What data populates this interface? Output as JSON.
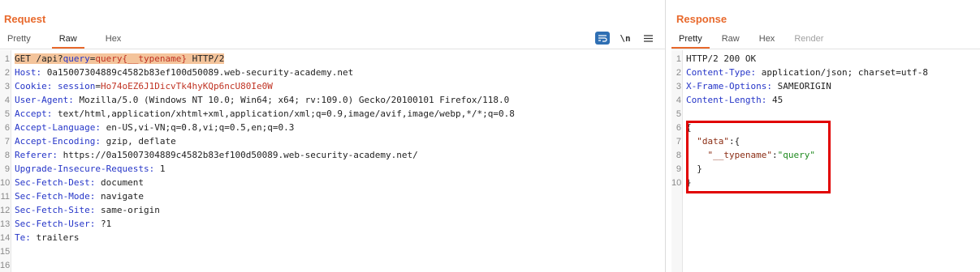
{
  "request": {
    "title": "Request",
    "tabs": [
      "Pretty",
      "Raw",
      "Hex"
    ],
    "active_tab": "Raw",
    "toolbar": {
      "pretty_toggle_icon": "wrap-lines-icon",
      "newline_label": "\\n",
      "menu_icon": "hamburger-icon"
    },
    "lines": [
      {
        "num": "1",
        "parts": [
          {
            "t": "GET /api?",
            "c": "hl"
          },
          {
            "t": "query",
            "c": "hl blue"
          },
          {
            "t": "=",
            "c": "hl"
          },
          {
            "t": "query{__typename}",
            "c": "hl red"
          },
          {
            "t": " HTTP/2",
            "c": "hl"
          }
        ]
      },
      {
        "num": "2",
        "parts": [
          {
            "t": "Host: ",
            "c": "blue"
          },
          {
            "t": "0a15007304889c4582b83ef100d50089.web-security-academy.net",
            "c": ""
          }
        ]
      },
      {
        "num": "3",
        "parts": [
          {
            "t": "Cookie: ",
            "c": "blue"
          },
          {
            "t": "session",
            "c": "blue"
          },
          {
            "t": "=",
            "c": ""
          },
          {
            "t": "Ho74oEZ6J1DicvTk4hyKQp6ncU80Ie0W",
            "c": "red"
          }
        ]
      },
      {
        "num": "4",
        "parts": [
          {
            "t": "User-Agent: ",
            "c": "blue"
          },
          {
            "t": "Mozilla/5.0 (Windows NT 10.0; Win64; x64; rv:109.0) Gecko/20100101 Firefox/118.0",
            "c": ""
          }
        ]
      },
      {
        "num": "5",
        "parts": [
          {
            "t": "Accept: ",
            "c": "blue"
          },
          {
            "t": "text/html,application/xhtml+xml,application/xml;q=0.9,image/avif,image/webp,*/*;q=0.8",
            "c": ""
          }
        ]
      },
      {
        "num": "6",
        "parts": [
          {
            "t": "Accept-Language: ",
            "c": "blue"
          },
          {
            "t": "en-US,vi-VN;q=0.8,vi;q=0.5,en;q=0.3",
            "c": ""
          }
        ]
      },
      {
        "num": "7",
        "parts": [
          {
            "t": "Accept-Encoding: ",
            "c": "blue"
          },
          {
            "t": "gzip, deflate",
            "c": ""
          }
        ]
      },
      {
        "num": "8",
        "parts": [
          {
            "t": "Referer: ",
            "c": "blue"
          },
          {
            "t": "https://0a15007304889c4582b83ef100d50089.web-security-academy.net/",
            "c": ""
          }
        ]
      },
      {
        "num": "9",
        "parts": [
          {
            "t": "Upgrade-Insecure-Requests: ",
            "c": "blue"
          },
          {
            "t": "1",
            "c": ""
          }
        ]
      },
      {
        "num": "10",
        "parts": [
          {
            "t": "Sec-Fetch-Dest: ",
            "c": "blue"
          },
          {
            "t": "document",
            "c": ""
          }
        ]
      },
      {
        "num": "11",
        "parts": [
          {
            "t": "Sec-Fetch-Mode: ",
            "c": "blue"
          },
          {
            "t": "navigate",
            "c": ""
          }
        ]
      },
      {
        "num": "12",
        "parts": [
          {
            "t": "Sec-Fetch-Site: ",
            "c": "blue"
          },
          {
            "t": "same-origin",
            "c": ""
          }
        ]
      },
      {
        "num": "13",
        "parts": [
          {
            "t": "Sec-Fetch-User: ",
            "c": "blue"
          },
          {
            "t": "?1",
            "c": ""
          }
        ]
      },
      {
        "num": "14",
        "parts": [
          {
            "t": "Te: ",
            "c": "blue"
          },
          {
            "t": "trailers",
            "c": ""
          }
        ]
      },
      {
        "num": "15",
        "parts": []
      },
      {
        "num": "16",
        "parts": []
      }
    ]
  },
  "response": {
    "title": "Response",
    "tabs": [
      "Pretty",
      "Raw",
      "Hex",
      "Render"
    ],
    "active_tab": "Pretty",
    "disabled_tabs": [
      "Render"
    ],
    "lines": [
      {
        "num": "1",
        "parts": [
          {
            "t": "HTTP/2 200 OK",
            "c": ""
          }
        ]
      },
      {
        "num": "2",
        "parts": [
          {
            "t": "Content-Type: ",
            "c": "blue"
          },
          {
            "t": "application/json; charset=utf-8",
            "c": ""
          }
        ]
      },
      {
        "num": "3",
        "parts": [
          {
            "t": "X-Frame-Options: ",
            "c": "blue"
          },
          {
            "t": "SAMEORIGIN",
            "c": ""
          }
        ]
      },
      {
        "num": "4",
        "parts": [
          {
            "t": "Content-Length: ",
            "c": "blue"
          },
          {
            "t": "45",
            "c": ""
          }
        ]
      },
      {
        "num": "5",
        "parts": []
      },
      {
        "num": "6",
        "parts": [
          {
            "t": "{",
            "c": ""
          }
        ]
      },
      {
        "num": "7",
        "parts": [
          {
            "t": "  ",
            "c": ""
          },
          {
            "t": "\"data\"",
            "c": "brown"
          },
          {
            "t": ":{",
            "c": ""
          }
        ]
      },
      {
        "num": "8",
        "parts": [
          {
            "t": "    ",
            "c": ""
          },
          {
            "t": "\"__typename\"",
            "c": "brown"
          },
          {
            "t": ":",
            "c": ""
          },
          {
            "t": "\"query\"",
            "c": "green"
          }
        ]
      },
      {
        "num": "9",
        "parts": [
          {
            "t": "  }",
            "c": ""
          }
        ]
      },
      {
        "num": "10",
        "parts": [
          {
            "t": "}",
            "c": ""
          }
        ]
      }
    ]
  },
  "colors": {
    "accent": "#e8692c",
    "highlight": "#f4c49b",
    "annotation_box": "#e10000"
  }
}
